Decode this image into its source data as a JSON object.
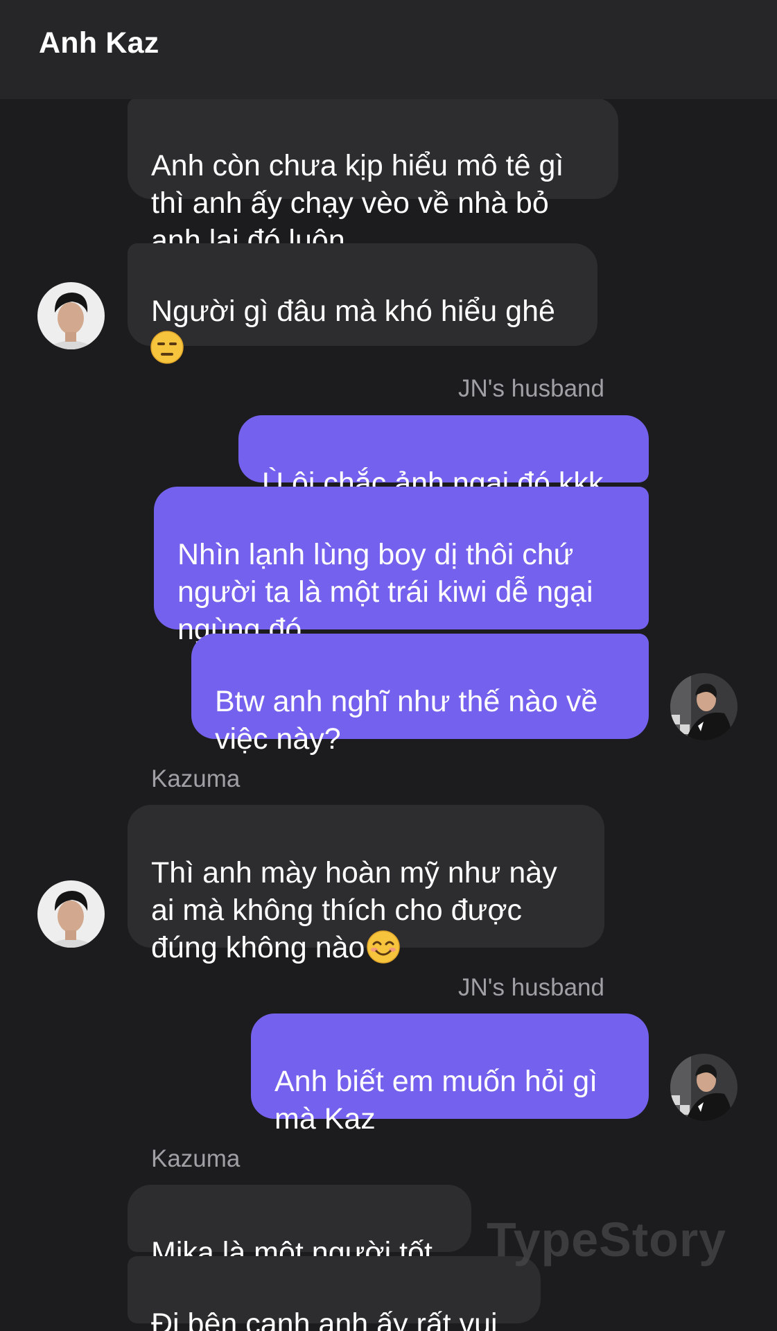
{
  "header": {
    "title": "Anh Kaz"
  },
  "messages": {
    "m1": "Anh còn chưa kịp hiểu mô tê gì\nthì anh ấy chạy vèo về nhà bỏ\nanh lại đó luôn",
    "m2": "Người gì đâu mà khó hiểu ghê",
    "sender_self_1": "JN's husband",
    "m3": "Ù ôi chắc ảnh ngại đó kkk",
    "m4": "Nhìn lạnh lùng boy dị thôi chứ\nngười ta là một trái kiwi dễ ngại\nngùng đó",
    "m5": "Btw anh nghĩ như thế nào về\nviệc này?",
    "sender_other_1": "Kazuma",
    "m6": "Thì anh mày hoàn mỹ như này\nai mà không thích cho được\nđúng không nào",
    "sender_self_2": "JN's husband",
    "m7": "Anh biết em muốn hỏi gì\nmà Kaz",
    "sender_other_2": "Kazuma",
    "m8": "Mika là một người tốt",
    "m9": "Đi bên cạnh anh ấy rất vui"
  },
  "emojis": {
    "m2": "expressionless-face",
    "m6": "smiling-face"
  },
  "watermark": "TypeStory",
  "colors": {
    "background": "#1c1c1e",
    "header": "#262628",
    "incoming_bubble": "#2d2d2f",
    "outgoing_bubble": "#7461ee",
    "sender_label": "#a0a0a5"
  }
}
